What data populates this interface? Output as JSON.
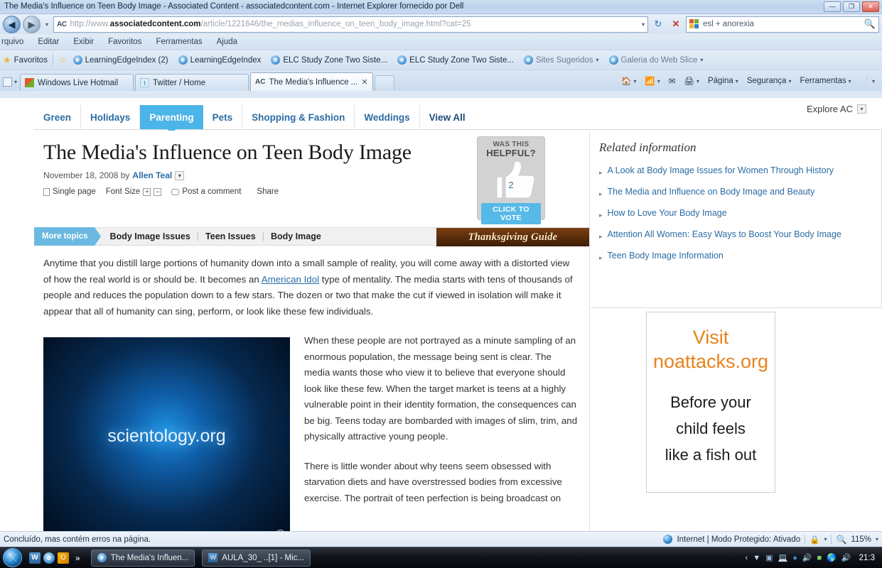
{
  "window": {
    "title": "The Media's Influence on Teen Body Image - Associated Content - associatedcontent.com - Internet Explorer fornecido por Dell",
    "minimize": "—",
    "maximize": "❐",
    "close": "✕"
  },
  "address": {
    "favicon_label": "AC",
    "url_protocol": "http://www.",
    "url_domain": "associatedcontent.com",
    "url_path": "/article/1221646/the_medias_influence_on_teen_body_image.html?cat=25",
    "dropdown": "▾",
    "refresh": "↻",
    "stop": "✕"
  },
  "search": {
    "value": "esl + anorexia",
    "icon": "search-icon"
  },
  "menu": {
    "items": [
      "rquivo",
      "Editar",
      "Exibir",
      "Favoritos",
      "Ferramentas",
      "Ajuda"
    ]
  },
  "favorites_bar": {
    "label": "Favoritos",
    "items": [
      {
        "label": "LearningEdgeIndex (2)",
        "icon": "ie-icon"
      },
      {
        "label": "LearningEdgeIndex",
        "icon": "ie-icon"
      },
      {
        "label": "ELC Study Zone Two Siste...",
        "icon": "ie-icon"
      },
      {
        "label": "ELC Study Zone Two Siste...",
        "icon": "ie-icon"
      },
      {
        "label": "Sites Sugeridos",
        "icon": "ie-icon",
        "caret": "▾"
      },
      {
        "label": "Galeria do Web Slice",
        "icon": "ie-icon",
        "caret": "▾"
      }
    ]
  },
  "tabs": {
    "items": [
      {
        "label": "Windows Live Hotmail",
        "icon": "windows-icon",
        "active": false
      },
      {
        "label": "Twitter / Home",
        "icon": "twitter-icon",
        "active": false
      },
      {
        "label": "The Media's Influence ...",
        "icon": "ac-icon",
        "active": true,
        "close": "✕"
      }
    ],
    "new_tab": ""
  },
  "command_bar": {
    "items": [
      {
        "label": "",
        "icon": "home-icon",
        "caret": "▾"
      },
      {
        "label": "",
        "icon": "rss-icon",
        "caret": "▾"
      },
      {
        "label": "",
        "icon": "mail-icon"
      },
      {
        "label": "",
        "icon": "print-icon",
        "caret": "▾"
      },
      {
        "label": "Página",
        "icon": "",
        "caret": "▾"
      },
      {
        "label": "Segurança",
        "icon": "",
        "caret": "▾"
      },
      {
        "label": "Ferramentas",
        "icon": "",
        "caret": "▾"
      },
      {
        "label": "",
        "icon": "help-icon",
        "caret": "▾"
      }
    ]
  },
  "site": {
    "nav": [
      {
        "label": "Green",
        "active": false
      },
      {
        "label": "Holidays",
        "active": false
      },
      {
        "label": "Parenting",
        "active": true
      },
      {
        "label": "Pets",
        "active": false
      },
      {
        "label": "Shopping & Fashion",
        "active": false
      },
      {
        "label": "Weddings",
        "active": false
      },
      {
        "label": "View All",
        "active": false
      }
    ],
    "explore": "Explore AC",
    "explore_caret": "▾"
  },
  "article": {
    "headline": "The Media's Influence on Teen Body Image",
    "date": "November 18, 2008 by",
    "author": "Allen Teal",
    "author_caret": "▾",
    "tools": {
      "single_page": "Single page",
      "font_size": "Font Size",
      "font_inc": "+",
      "font_dec": "−",
      "comment": "Post a comment",
      "share": "Share"
    },
    "helpful": {
      "line1": "WAS THIS",
      "line2": "HELPFUL?",
      "count": "2",
      "vote": "CLICK TO VOTE"
    },
    "topics_label": "More topics",
    "topics": [
      "Body Image Issues",
      "Teen Issues",
      "Body Image"
    ],
    "topics_sep": "|",
    "banner": "Thanksgiving Guide",
    "paragraph1_a": "Anytime that you distill large portions of humanity down into a small sample of reality, you will come away with a distorted view of how the real world is or should be. It becomes an ",
    "paragraph1_link": "American Idol",
    "paragraph1_b": " type of mentality. The media starts with tens of thousands of people and reduces the population down to a few stars. The dozen or two that make the cut if viewed in isolation will make it appear that all of humanity can sing, perform, or look like these few individuals.",
    "paragraph2": "When these people are not portrayed as a minute sampling of an enormous population, the message being sent is clear. The media wants those who view it to believe that everyone should look like these few. When the target market is teens at a highly vulnerable point in their identity formation, the consequences can be big. Teens today are bombarded with images of slim, trim, and physically attractive young people.",
    "paragraph3": "There is little wonder about why teens seem obsessed with starvation diets and have overstressed bodies from excessive exercise. The portrait of teen perfection is being broadcast on",
    "figure_caption": "scientology.org",
    "figure_info": "i"
  },
  "related": {
    "title": "Related information",
    "bullet": "▸",
    "links": [
      "A Look at Body Image Issues for Women Through History",
      "The Media and Influence on Body Image and Beauty",
      "How to Love Your Body Image",
      "Attention All Women: Easy Ways to Boost Your Body Image",
      "Teen Body Image Information"
    ]
  },
  "ad": {
    "line1": "Visit",
    "line2": "noattacks.org",
    "line3": "Before your",
    "line4": "child feels",
    "line5": "like a fish out"
  },
  "status": {
    "message": "Concluído, mas contém erros na página.",
    "zone": "Internet | Modo Protegido: Ativado",
    "zone_caret": "▾",
    "zoom": "115%",
    "zoom_caret": "▾"
  },
  "taskbar": {
    "start": "start-orb",
    "quicklaunch": [
      {
        "icon": "word-icon",
        "label": "W"
      },
      {
        "icon": "ie-icon",
        "label": "e"
      },
      {
        "icon": "opera-icon",
        "label": "O"
      }
    ],
    "more": "»",
    "items": [
      {
        "label": "The Media's Influen...",
        "icon": "ie-icon"
      },
      {
        "label": "AULA_30_ ..[1] - Mic...",
        "icon": "word-icon"
      }
    ],
    "tray_caret": "‹",
    "clock": "21:3"
  },
  "colors": {
    "accent_blue": "#4bb4e8",
    "link_blue": "#2b6ca3",
    "ad_orange": "#e8821e",
    "banner_brown": "#7a3f12"
  }
}
